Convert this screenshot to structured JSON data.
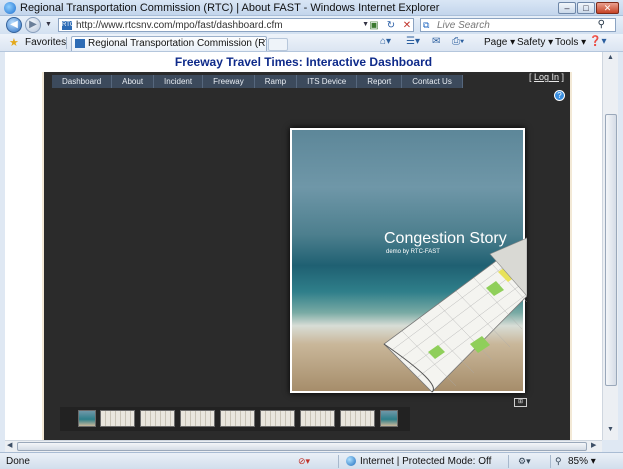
{
  "window": {
    "title": "Regional Transportation Commission (RTC) | About FAST - Windows Internet Explorer",
    "minimize": "–",
    "maximize": "□",
    "close": "✕"
  },
  "address_bar": {
    "url": "http://www.rtcsnv.com/mpo/fast/dashboard.cfm",
    "search_placeholder": "Live Search"
  },
  "favorites_bar": {
    "favorites_label": "Favorites",
    "tab_label": "Regional Transportation Commission (RTC) | Ab...",
    "commands": [
      "Page",
      "Safety",
      "Tools"
    ]
  },
  "page": {
    "heading": "Freeway Travel Times: Interactive Dashboard",
    "login_label": "Log In",
    "login_open": "[ ",
    "login_close": " ]",
    "menu": [
      "Dashboard",
      "About",
      "Incident",
      "Freeway",
      "Ramp",
      "ITS Device",
      "Report",
      "Contact Us"
    ],
    "cover_title": "Congestion Story",
    "cover_subtitle": "demo by RTC-FAST",
    "thumbnail_count": 9
  },
  "status_bar": {
    "status": "Done",
    "zone": "Internet | Protected Mode: Off",
    "zoom": "85%"
  },
  "colors": {
    "heading": "#0e2a8a",
    "menu_bg": "#3c4a5c",
    "dashboard_bg": "#2b2b2b",
    "cover_highlight": "#e8e25a",
    "cover_green": "#8fcf5a"
  }
}
